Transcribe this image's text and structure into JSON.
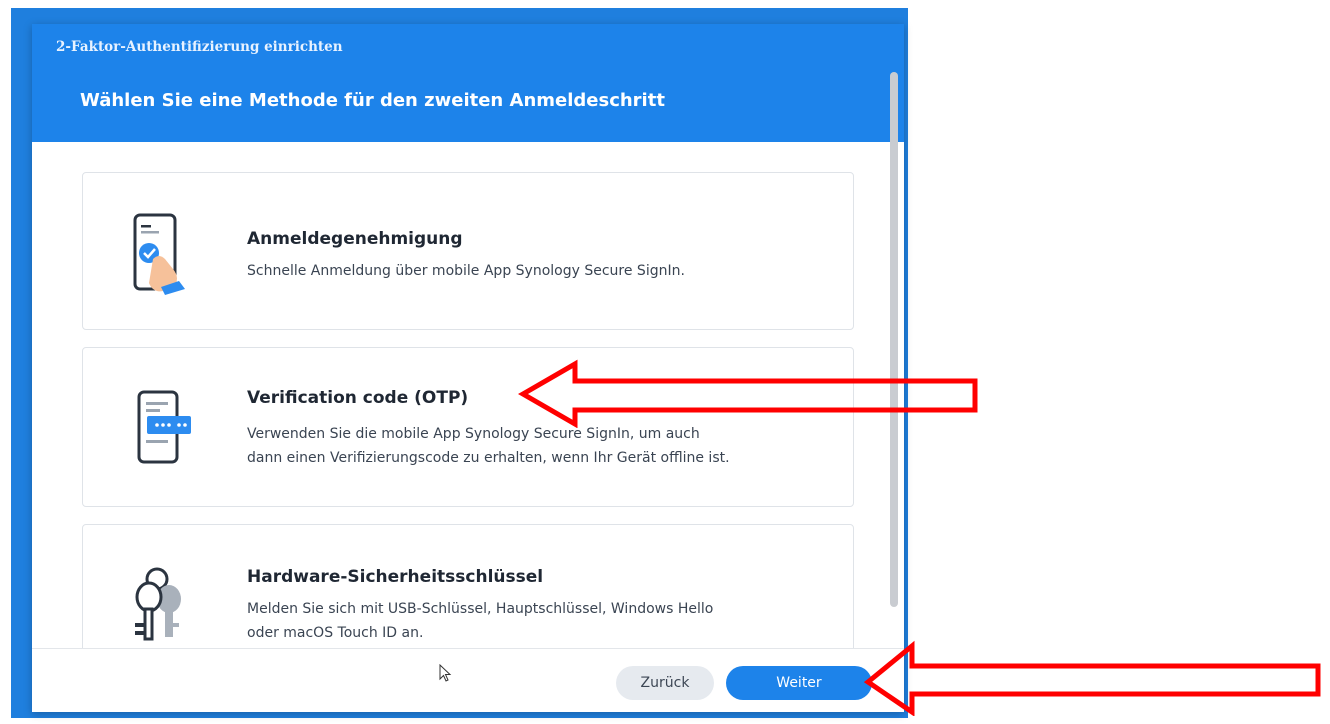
{
  "dialog": {
    "subtitle": "2-Faktor-Authentifizierung einrichten",
    "title": "Wählen Sie eine Methode für den zweiten Anmeldeschritt"
  },
  "options": [
    {
      "title": "Anmeldegenehmigung",
      "description": "Schnelle Anmeldung über mobile App Synology Secure SignIn.",
      "icon": "phone-approval-icon"
    },
    {
      "title": "Verification code (OTP)",
      "description_lines": [
        "Verwenden Sie die mobile App Synology Secure SignIn, um auch",
        "dann einen Verifizierungscode zu erhalten, wenn Ihr Gerät offline ist."
      ],
      "icon": "phone-otp-icon"
    },
    {
      "title": "Hardware-Sicherheitsschlüssel",
      "description_lines": [
        "Melden Sie sich mit USB-Schlüssel, Hauptschlüssel, Windows Hello",
        "oder macOS Touch ID an."
      ],
      "icon": "keys-icon"
    }
  ],
  "footer": {
    "back_label": "Zurück",
    "next_label": "Weiter"
  },
  "colors": {
    "accent": "#1d83ea",
    "annotation_arrow": "#ff0000"
  }
}
